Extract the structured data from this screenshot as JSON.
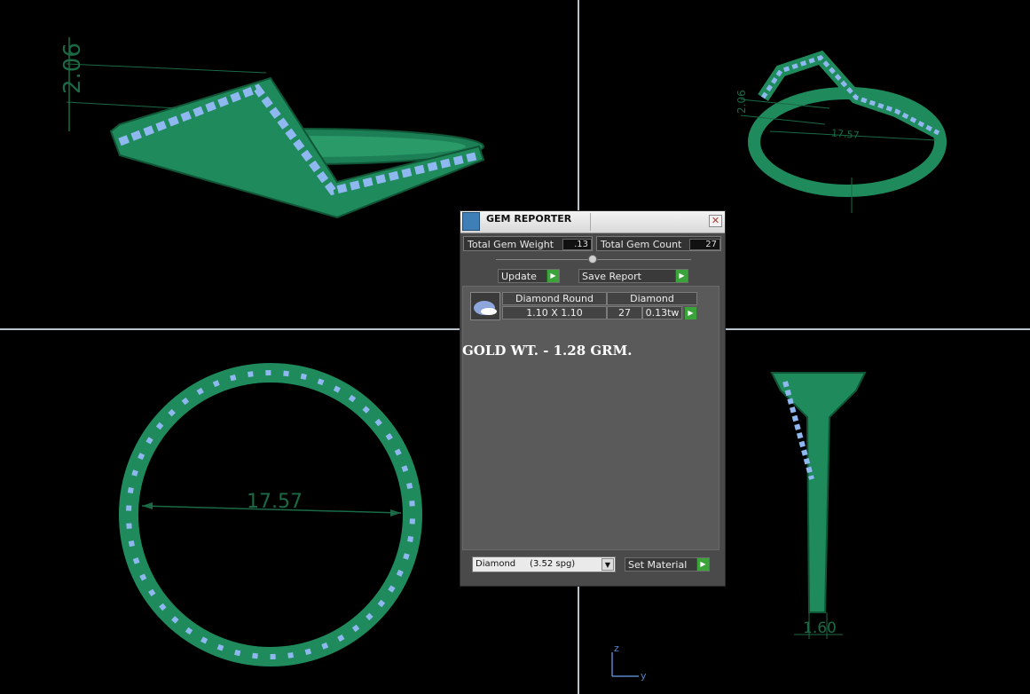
{
  "viewport": {
    "background": "#000000",
    "model_color": "#1f8a5c",
    "gem_color": "#8fb8f0",
    "dim_color": "#1b6a45",
    "dimensions": {
      "front_height": "2.06",
      "top_right_height": "2.06",
      "top_right_width": "17.57",
      "circle_diameter": "17.57",
      "side_width": "1.60"
    },
    "axis": {
      "z": "z",
      "y": "y"
    }
  },
  "panel": {
    "title": "GEM REPORTER",
    "close_icon": "close-icon",
    "total_gem_weight_label": "Total Gem Weight",
    "total_gem_weight_value": ".13",
    "total_gem_count_label": "Total Gem Count",
    "total_gem_count_value": "27",
    "update_label": "Update",
    "save_report_label": "Save Report",
    "gem_row": {
      "shape_header": "Diamond Round",
      "material_header": "Diamond",
      "size": "1.10 X 1.10",
      "count": "27",
      "weight": "0.13tw"
    },
    "gold_weight_text": "GOLD WT. - 1.28 GRM.",
    "material_select_value": "Diamond     (3.52 spg)",
    "set_material_label": "Set Material"
  }
}
